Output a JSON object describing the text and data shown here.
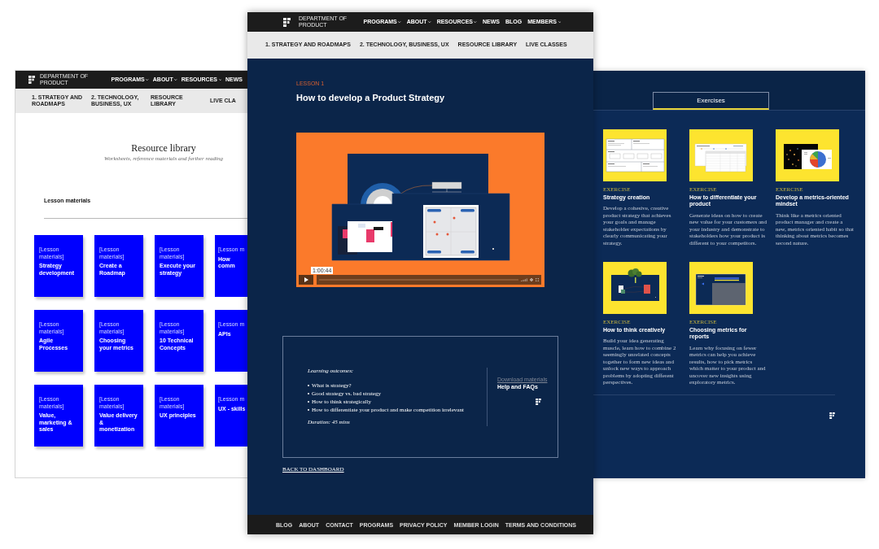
{
  "library_page": {
    "nav": {
      "brand": "DEPARTMENT OF PRODUCT",
      "links": [
        {
          "label": "PROGRAMS",
          "dropdown": true
        },
        {
          "label": "ABOUT",
          "dropdown": true
        },
        {
          "label": "RESOURCES",
          "dropdown": true
        },
        {
          "label": "NEWS",
          "dropdown": false
        }
      ]
    },
    "subnav": [
      "1. STRATEGY AND ROADMAPS",
      "2. TECHNOLOGY, BUSINESS, UX",
      "RESOURCE LIBRARY",
      "LIVE CLA"
    ],
    "title": "Resource library",
    "subtitle": "Worksheets, reference materials and further reading",
    "section_heading": "Lesson materials",
    "cards": [
      {
        "label": "[Lesson materials]",
        "title": "Strategy development"
      },
      {
        "label": "[Lesson materials]",
        "title": "Create a Roadmap"
      },
      {
        "label": "[Lesson materials]",
        "title": "Execute your strategy"
      },
      {
        "label": "[Lesson m",
        "title": "How comm"
      },
      {
        "label": "[Lesson materials]",
        "title": "Agile Processes"
      },
      {
        "label": "[Lesson materials]",
        "title": "Choosing your metrics"
      },
      {
        "label": "[Lesson materials]",
        "title": "10 Technical Concepts"
      },
      {
        "label": "[Lesson m",
        "title": "APIs"
      },
      {
        "label": "[Lesson materials]",
        "title": "Value, marketing & sales"
      },
      {
        "label": "[Lesson materials]",
        "title": "Value delivery & monetization"
      },
      {
        "label": "[Lesson materials]",
        "title": "UX principles"
      },
      {
        "label": "[Lesson m",
        "title": "UX - skills"
      }
    ]
  },
  "lesson_page": {
    "nav": {
      "brand": "DEPARTMENT OF PRODUCT",
      "links": [
        {
          "label": "PROGRAMS",
          "dropdown": true
        },
        {
          "label": "ABOUT",
          "dropdown": true
        },
        {
          "label": "RESOURCES",
          "dropdown": true
        },
        {
          "label": "NEWS",
          "dropdown": false
        },
        {
          "label": "BLOG",
          "dropdown": false
        },
        {
          "label": "MEMBERS",
          "dropdown": true
        }
      ]
    },
    "subnav": [
      "1. STRATEGY AND ROADMAPS",
      "2. TECHNOLOGY, BUSINESS, UX",
      "RESOURCE LIBRARY",
      "LIVE CLASSES"
    ],
    "eyebrow": "LESSON 1",
    "title": "How to develop a Product Strategy",
    "video": {
      "time": "1:00:44"
    },
    "outcomes": {
      "heading": "Learning outcomes:",
      "items": [
        "What is strategy?",
        "Good strategy vs. bad strategy",
        "How to think strategically",
        "How to differentiate your product and make competition irrelevant"
      ],
      "duration": "Duration: 45 mins"
    },
    "links": [
      {
        "label": "Download materials",
        "disabled": true
      },
      {
        "label": "Help and FAQs",
        "disabled": false
      }
    ],
    "back_link": "BACK TO DASHBOARD",
    "footer_links": [
      "BLOG",
      "ABOUT",
      "CONTACT",
      "PROGRAMS",
      "PRIVACY POLICY",
      "MEMBER LOGIN",
      "TERMS AND CONDITIONS"
    ]
  },
  "exercises_page": {
    "tab": {
      "label": "Exercises",
      "selected": true
    },
    "cards": [
      {
        "kind": "worksheet",
        "label": "EXERCISE",
        "title": "Strategy creation",
        "description": "Develop a cohesive, creative product strategy that achieves your goals and manage stakeholder expectations by clearly communicating your strategy."
      },
      {
        "kind": "table",
        "label": "EXERCISE",
        "title": "How to differentiate your product",
        "description": "Generate ideas on how to create new value for your customers and your industry and demonstrate to stakeholders how your product is different to your competitors."
      },
      {
        "kind": "pie_chart",
        "label": "EXERCISE",
        "title": "Develop a metrics-oriented mindset",
        "description": "Think like a metrics oriented product manager and create a new, metrics oriented habit so that thinking about metrics becomes second nature."
      },
      {
        "kind": "slide",
        "label": "EXERCISE",
        "title": "How to think creatively",
        "description": "Build your idea generating muscle, learn how to combine 2 seemingly unrelated concepts together to form new ideas and unlock new ways to approach problems by adopting different perspectives."
      },
      {
        "kind": "photo_slide",
        "label": "EXERCISE",
        "title": "Choosing metrics for reports",
        "description": "Learn why focusing on fewer metrics can help you achieve results, how to pick metrics which matter to your product and uncover new insights using exploratory metrics."
      }
    ]
  }
}
